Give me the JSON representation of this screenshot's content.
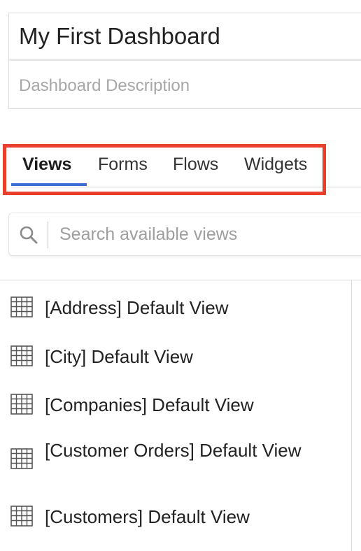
{
  "dashboard": {
    "title_value": "My First Dashboard",
    "description_placeholder": "Dashboard Description"
  },
  "tabs": [
    {
      "label": "Views",
      "active": true
    },
    {
      "label": "Forms",
      "active": false
    },
    {
      "label": "Flows",
      "active": false
    },
    {
      "label": "Widgets",
      "active": false
    }
  ],
  "search": {
    "placeholder": "Search available views",
    "icon": "search-icon"
  },
  "views": [
    {
      "label": "[Address] Default View",
      "icon": "table-grid-icon"
    },
    {
      "label": "[City] Default View",
      "icon": "table-grid-icon"
    },
    {
      "label": "[Companies] Default View",
      "icon": "table-grid-icon"
    },
    {
      "label": "[Customer Orders] Default View",
      "icon": "table-grid-icon"
    },
    {
      "label": "[Customers] Default View",
      "icon": "table-grid-icon"
    }
  ],
  "colors": {
    "accent": "#3b6fd1",
    "highlight": "#e8402c"
  }
}
